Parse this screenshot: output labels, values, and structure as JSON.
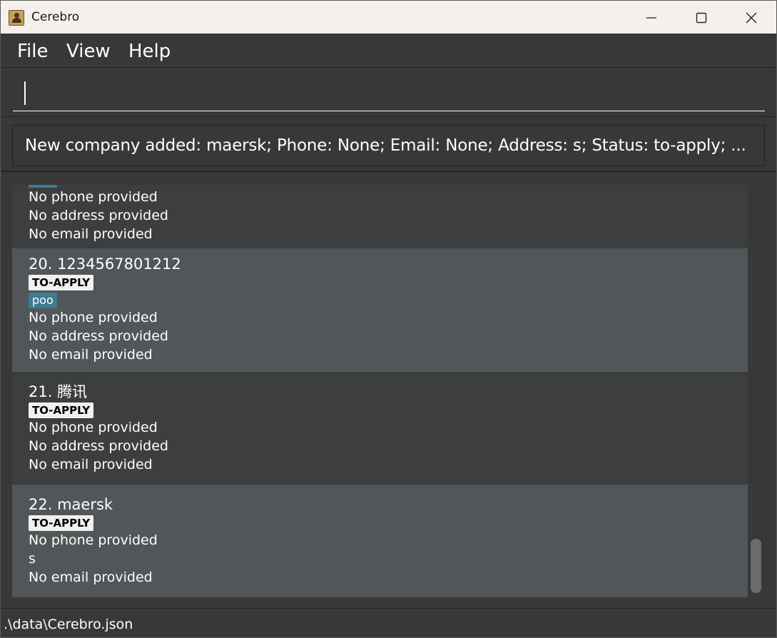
{
  "window": {
    "title": "Cerebro"
  },
  "menu": {
    "file": "File",
    "view": "View",
    "help": "Help"
  },
  "command": {
    "value": ""
  },
  "result": {
    "message": "New company added: maersk; Phone: None; Email: None; Address: s; Status: to-apply; ..."
  },
  "list": {
    "partial": {
      "phone": "No phone provided",
      "address": "No address provided",
      "email": "No email provided"
    },
    "cards": [
      {
        "title": "20. 1234567801212",
        "status": "TO-APPLY",
        "tag": "poo",
        "phone": "No phone provided",
        "address": "No address provided",
        "email": "No email provided"
      },
      {
        "title": "21. 腾讯",
        "status": "TO-APPLY",
        "phone": "No phone provided",
        "address": "No address provided",
        "email": "No email provided"
      },
      {
        "title": "22. maersk",
        "status": "TO-APPLY",
        "phone": "No phone provided",
        "address": "s",
        "email": "No email provided"
      }
    ]
  },
  "statusbar": {
    "path": ".\\data\\Cerebro.json"
  },
  "colors": {
    "background": "#383838",
    "card_dark": "#3c3e3f",
    "card_light": "#515658",
    "tag": "#3e7b91",
    "status_badge": "#f0f0f0",
    "titlebar": "#f4f1ec"
  },
  "icons": [
    "app-icon",
    "minimize-icon",
    "maximize-icon",
    "close-icon"
  ]
}
